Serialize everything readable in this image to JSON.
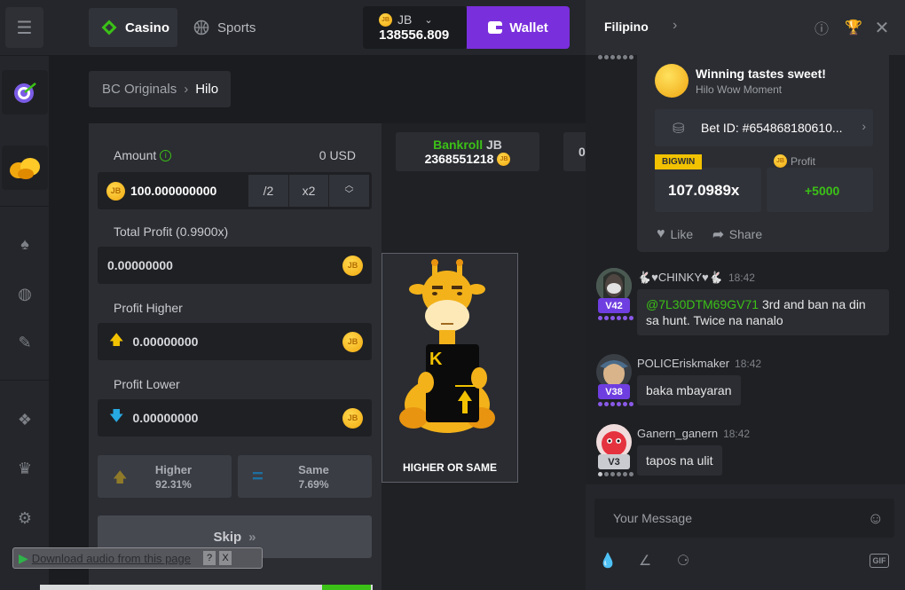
{
  "topbar": {
    "casino_label": "Casino",
    "sports_label": "Sports",
    "currency": "JB",
    "balance": "138556.809",
    "wallet_label": "Wallet"
  },
  "breadcrumb": {
    "parent": "BC Originals",
    "current": "Hilo"
  },
  "bet_panel": {
    "amount_label": "Amount",
    "amount_usd": "0 USD",
    "amount_value": "100.000000000",
    "half_label": "/2",
    "double_label": "x2",
    "total_profit_label": "Total Profit (0.9900x)",
    "total_profit_value": "0.00000000",
    "profit_higher_label": "Profit Higher",
    "profit_higher_value": "0.00000000",
    "profit_lower_label": "Profit Lower",
    "profit_lower_value": "0.00000000",
    "higher_label": "Higher",
    "higher_pct": "92.31%",
    "same_label": "Same",
    "same_pct": "7.69%",
    "skip_label": "Skip"
  },
  "game": {
    "bankroll_label": "Bankroll",
    "bankroll_currency": "JB",
    "bankroll_value": "2368551218",
    "bankroll2_partial": "0",
    "card_rank": "K",
    "card_caption": "HIGHER OR SAME"
  },
  "download_bar": {
    "text": "Download audio from this page",
    "help": "?",
    "close": "X"
  },
  "chat": {
    "language": "Filipino",
    "share": {
      "title": "Winning tastes sweet!",
      "subtitle": "Hilo Wow Moment",
      "bet_id": "Bet ID: #654868180610...",
      "badge": "BIGWIN",
      "multiplier": "107.0989x",
      "profit_label": "Profit",
      "profit_value": "+5000",
      "like_label": "Like",
      "share_label": "Share"
    },
    "messages": [
      {
        "user": "🐇♥CHINKY♥🐇",
        "time": "18:42",
        "vip": "V42",
        "mention": "@7L30DTM69GV71",
        "text_line1": " 3rd and ban na din",
        "text_line2": "sa hunt. Twice na nanalo"
      },
      {
        "user": "POLICEriskmaker",
        "time": "18:42",
        "vip": "V38",
        "text": "baka mbayaran"
      },
      {
        "user": "Ganern_ganern",
        "time": "18:42",
        "vip": "V3",
        "text": "tapos na ulit"
      }
    ],
    "input_placeholder": "Your Message",
    "gif_label": "GIF"
  },
  "colors": {
    "accent": "#7a2fdc",
    "green": "#3bc117",
    "gold": "#f2c200",
    "vip_purple": "#6f3ee0",
    "vip_grey": "#c9cbd0"
  }
}
